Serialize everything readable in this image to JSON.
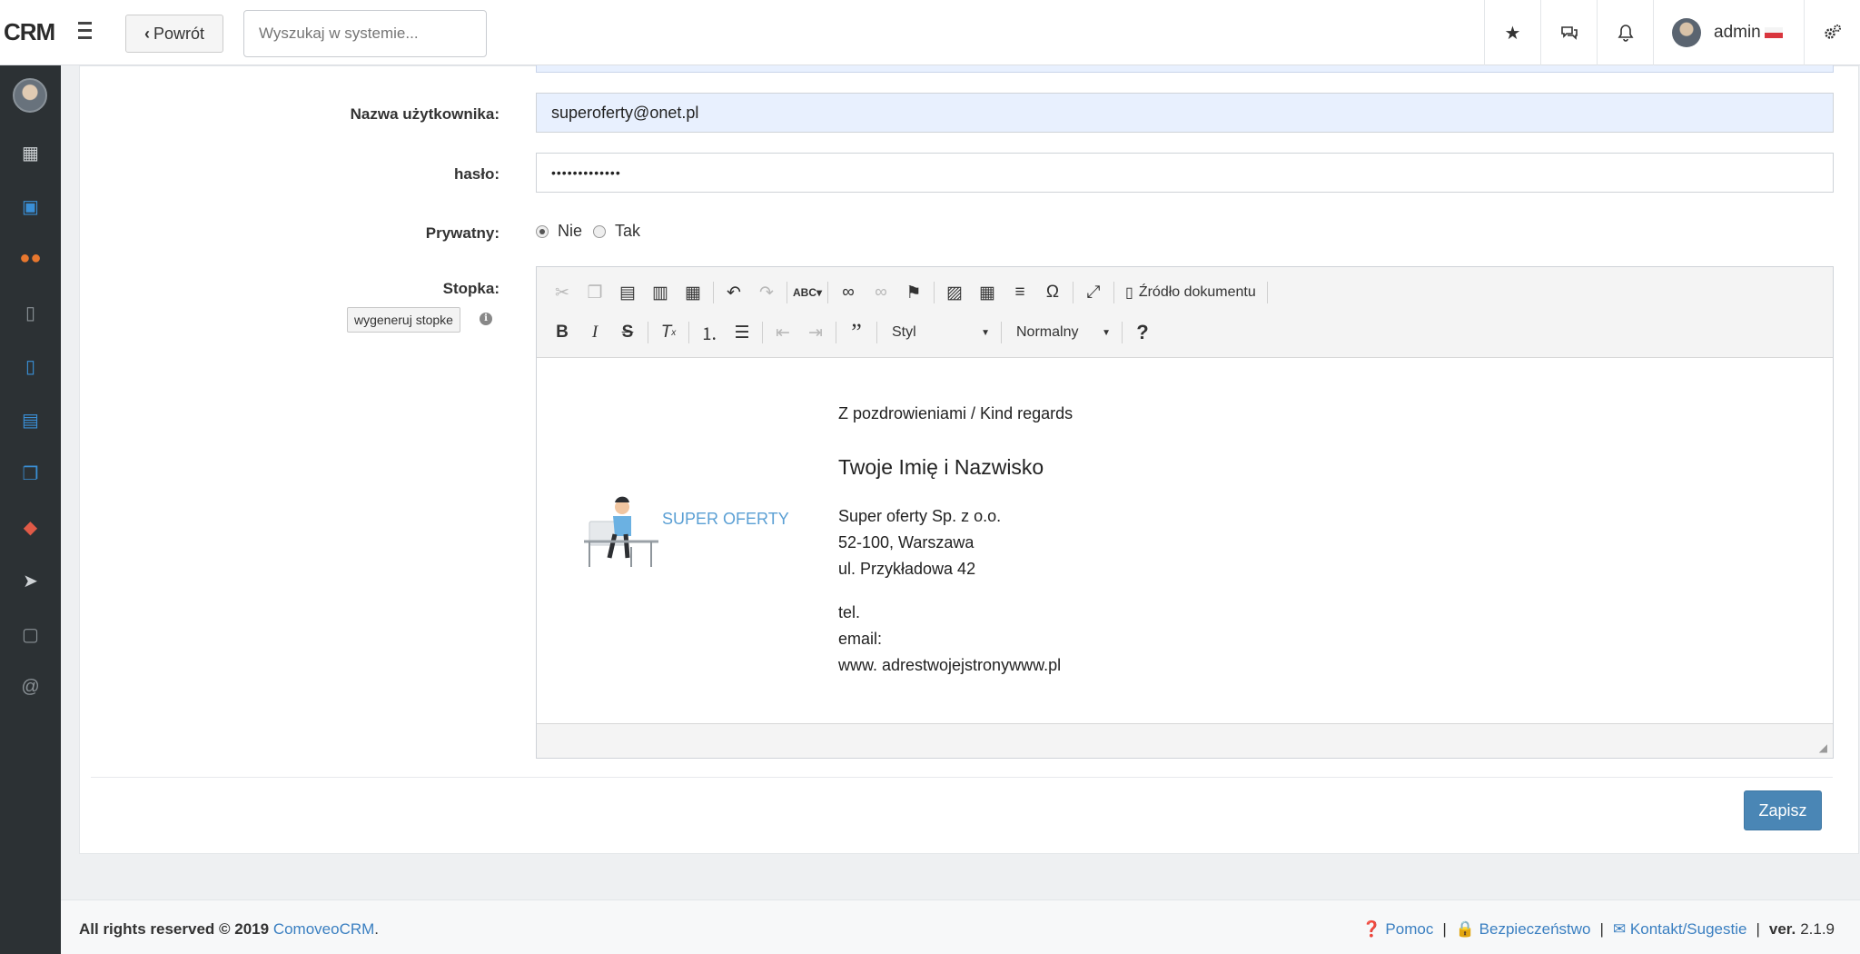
{
  "app": {
    "logo": "CRM"
  },
  "header": {
    "back_label": "Powrót",
    "search_placeholder": "Wyszukaj w systemie...",
    "user_name": "admin"
  },
  "icons": {
    "menu": "hamburger-icon",
    "back": "chevron-left-icon",
    "favorites": "star-icon",
    "messages": "chat-icon",
    "notifications": "bell-icon",
    "settings": "gears-icon"
  },
  "sidebar": {
    "items": [
      {
        "icon": "calendar-icon",
        "color": "#cfd3d6"
      },
      {
        "icon": "calendar-check-icon",
        "color": "#3a8fd6"
      },
      {
        "icon": "users-icon",
        "color": "#e8772e"
      },
      {
        "icon": "document-icon",
        "color": "#8b9297"
      },
      {
        "icon": "pdf-icon",
        "color": "#3a8fd6"
      },
      {
        "icon": "clipboard-icon",
        "color": "#3a8fd6"
      },
      {
        "icon": "copy-icon",
        "color": "#3a8fd6"
      },
      {
        "icon": "ticket-icon",
        "color": "#e05a47"
      },
      {
        "icon": "send-icon",
        "color": "#cfd3d6"
      },
      {
        "icon": "note-icon",
        "color": "#8b9297"
      },
      {
        "icon": "at-icon",
        "color": "#8b9297"
      }
    ]
  },
  "form": {
    "username_label": "Nazwa użytkownika:",
    "username_value": "superoferty@onet.pl",
    "password_label": "hasło:",
    "password_value": "•••••••••••••",
    "private_label": "Prywatny:",
    "private_no": "Nie",
    "private_yes": "Tak",
    "footer_label": "Stopka:",
    "generate_button": "wygeneruj stopke",
    "save_button": "Zapisz"
  },
  "editor": {
    "source_label": "Źródło dokumentu",
    "style_label": "Styl",
    "format_label": "Normalny",
    "help_label": "?"
  },
  "signature": {
    "greeting": "Z pozdrowieniami / Kind regards",
    "name": "Twoje Imię i Nazwisko",
    "company": "Super oferty Sp. z o.o.",
    "city": "52-100, Warszawa",
    "street": "ul. Przykładowa 42",
    "tel": "tel.",
    "email": "email:",
    "www": "www. adrestwojejstronywww.pl",
    "logo_text": "SUPER OFERTY"
  },
  "footer": {
    "rights": "All rights reserved © 2019",
    "brand": "ComoveoCRM",
    "help": "Pomoc",
    "security": "Bezpieczeństwo",
    "contact": "Kontakt/Sugestie",
    "version_label": "ver.",
    "version": "2.1.9"
  },
  "colors": {
    "sidebar_bg": "#2c3134",
    "accent": "#4a86b5",
    "link": "#3a7fc1",
    "autofill": "#e8f0fe"
  }
}
